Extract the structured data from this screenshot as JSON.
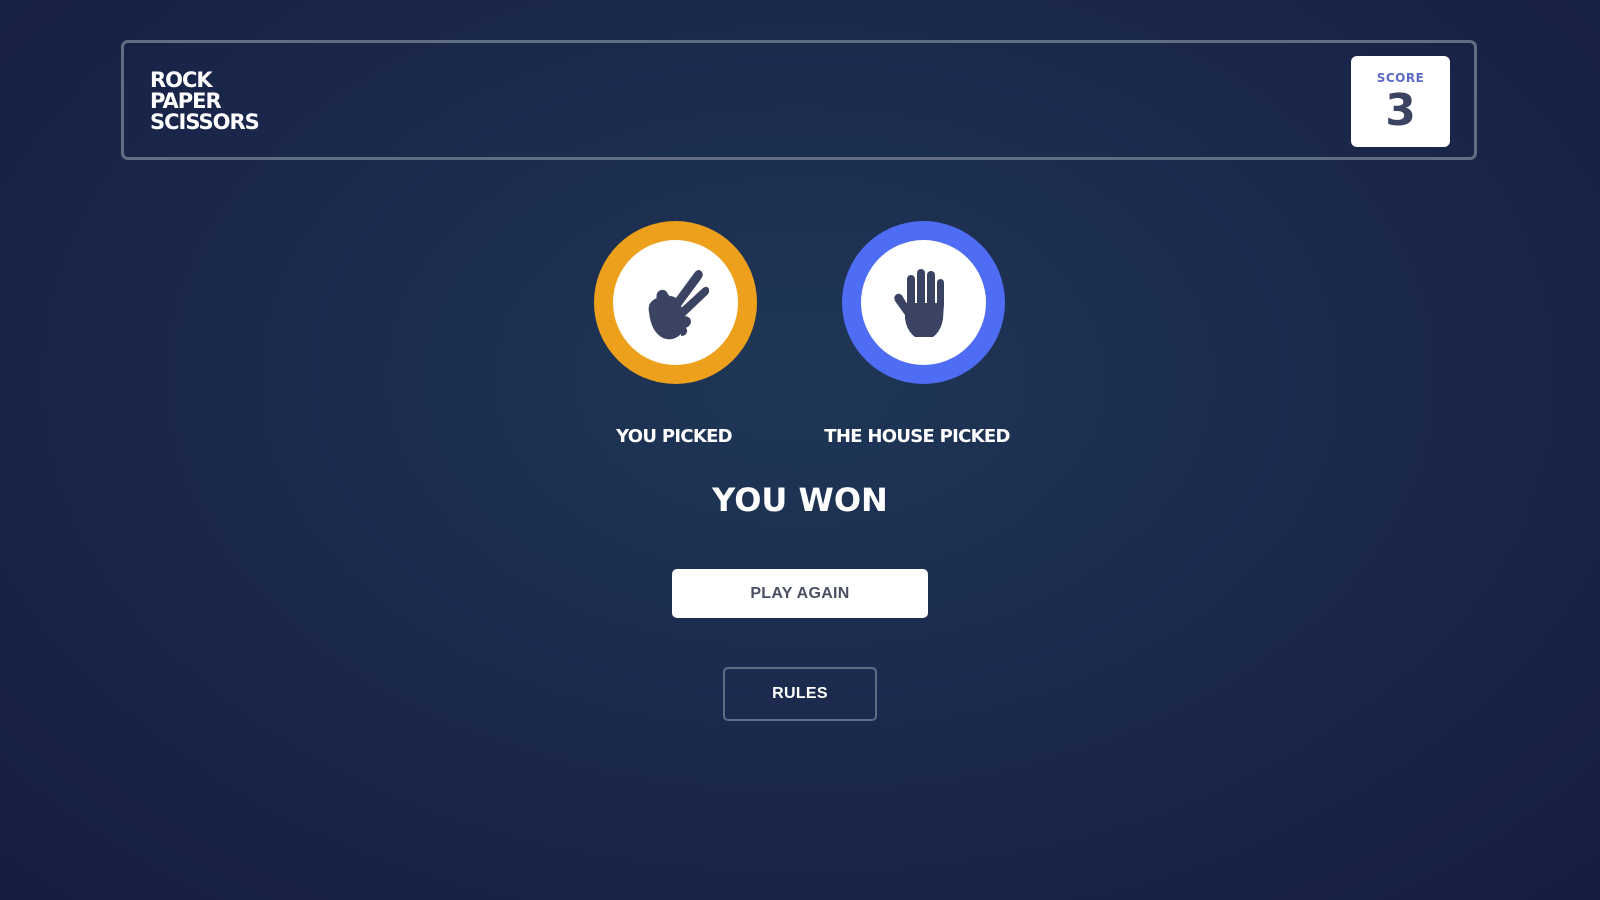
{
  "header": {
    "title_lines": [
      "ROCK",
      "PAPER",
      "SCISSORS"
    ],
    "score_label": "SCORE",
    "score_value": "3"
  },
  "game": {
    "you_picked_label": "YOU PICKED",
    "house_picked_label": "THE HOUSE PICKED",
    "you_pick": "scissors",
    "house_pick": "paper",
    "result": "YOU WON"
  },
  "buttons": {
    "play_again_label": "PLAY AGAIN",
    "rules_label": "RULES"
  },
  "colors": {
    "scissors_ring": "#eca01b",
    "paper_ring": "#4f6cf4",
    "hand_icon": "#3b4363",
    "score_label": "#5a69c4",
    "header_border": "#606e85"
  },
  "icons": {
    "you_pick_icon": "scissors-hand-icon",
    "house_pick_icon": "paper-hand-icon"
  }
}
